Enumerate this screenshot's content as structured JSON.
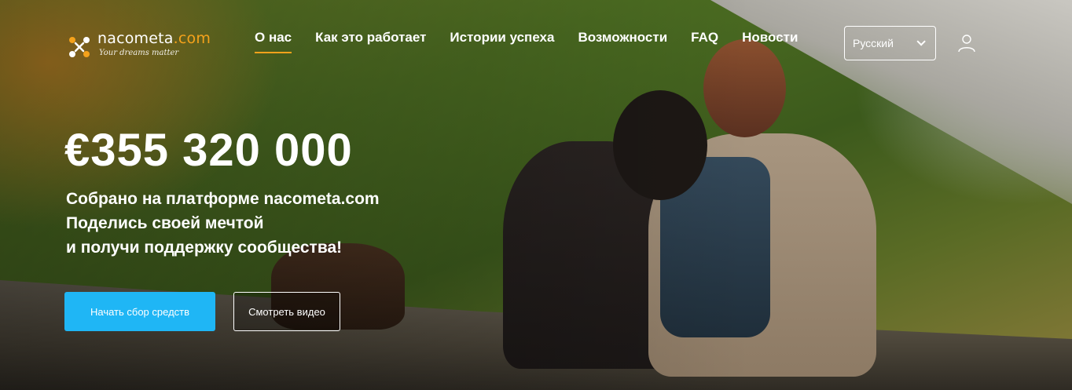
{
  "header": {
    "logo": {
      "name": "nacometa",
      "domain": ".com",
      "tagline": "Your dreams matter"
    },
    "nav": [
      {
        "label": "О нас",
        "active": true
      },
      {
        "label": "Как это работает",
        "active": false
      },
      {
        "label": "Истории успеха",
        "active": false
      },
      {
        "label": "Возможности",
        "active": false
      },
      {
        "label": "FAQ",
        "active": false
      },
      {
        "label": "Новости",
        "active": false
      }
    ],
    "language": {
      "selected": "Русский"
    },
    "user_icon": "user-icon"
  },
  "hero": {
    "amount": "€355 320 000",
    "lines": [
      "Собрано на платформе nacometa.com",
      "Поделись своей мечтой",
      "и получи поддержку сообщества!"
    ],
    "primary_button": "Начать сбор средств",
    "secondary_button": "Смотреть видео"
  },
  "colors": {
    "accent": "#f5a21b",
    "primary_button": "#1fb6f5"
  }
}
